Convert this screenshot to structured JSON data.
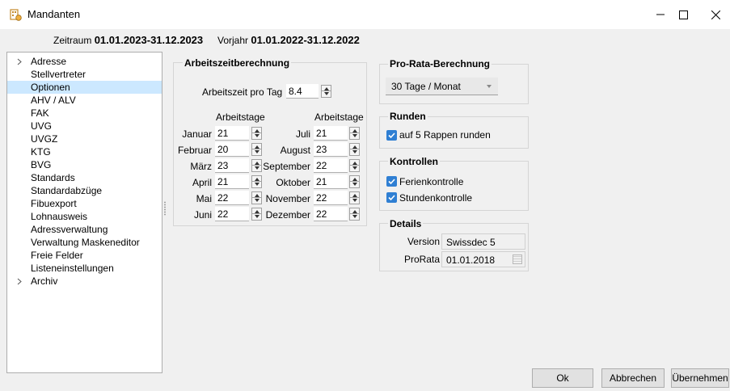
{
  "window": {
    "title": "Mandanten",
    "icon": "mandant-building-icon"
  },
  "header": {
    "period_label": "Zeitraum",
    "period_value": "01.01.2023-31.12.2023",
    "prev_label": "Vorjahr",
    "prev_value": "01.01.2022-31.12.2022"
  },
  "tree": {
    "items": [
      {
        "label": "Adresse"
      },
      {
        "label": "Stellvertreter"
      },
      {
        "label": "Optionen"
      },
      {
        "label": "AHV / ALV"
      },
      {
        "label": "FAK"
      },
      {
        "label": "UVG"
      },
      {
        "label": "UVGZ"
      },
      {
        "label": "KTG"
      },
      {
        "label": "BVG"
      },
      {
        "label": "Standards"
      },
      {
        "label": "Standardabzüge"
      },
      {
        "label": "Fibuexport"
      },
      {
        "label": "Lohnausweis"
      },
      {
        "label": "Adressverwaltung"
      },
      {
        "label": "Verwaltung Maskeneditor"
      },
      {
        "label": "Freie Felder"
      },
      {
        "label": "Listeneinstellungen"
      },
      {
        "label": "Archiv"
      }
    ]
  },
  "arbeitszeit": {
    "title": "Arbeitszeitberechnung",
    "per_day_label": "Arbeitszeit pro Tag",
    "per_day_value": "8.4",
    "col_header": "Arbeitstage",
    "months_left": [
      {
        "month": "Januar",
        "days": "21"
      },
      {
        "month": "Februar",
        "days": "20"
      },
      {
        "month": "März",
        "days": "23"
      },
      {
        "month": "April",
        "days": "21"
      },
      {
        "month": "Mai",
        "days": "22"
      },
      {
        "month": "Juni",
        "days": "22"
      }
    ],
    "months_right": [
      {
        "month": "Juli",
        "days": "21"
      },
      {
        "month": "August",
        "days": "23"
      },
      {
        "month": "September",
        "days": "22"
      },
      {
        "month": "Oktober",
        "days": "21"
      },
      {
        "month": "November",
        "days": "22"
      },
      {
        "month": "Dezember",
        "days": "22"
      }
    ]
  },
  "prorata": {
    "title": "Pro-Rata-Berechnung",
    "selected": "30 Tage / Monat"
  },
  "runden": {
    "title": "Runden",
    "option": "auf 5 Rappen runden",
    "checked": true
  },
  "kontrollen": {
    "title": "Kontrollen",
    "ferien": "Ferienkontrolle",
    "ferien_checked": true,
    "stunden": "Stundenkontrolle",
    "stunden_checked": true
  },
  "details": {
    "title": "Details",
    "version_label": "Version",
    "version_value": "Swissdec 5",
    "prorata_label": "ProRata",
    "prorata_value": "01.01.2018"
  },
  "buttons": {
    "ok": "Ok",
    "cancel": "Abbrechen",
    "apply": "Übernehmen"
  },
  "colors": {
    "selection": "#cce8ff",
    "checkbox": "#2f7fd3"
  }
}
